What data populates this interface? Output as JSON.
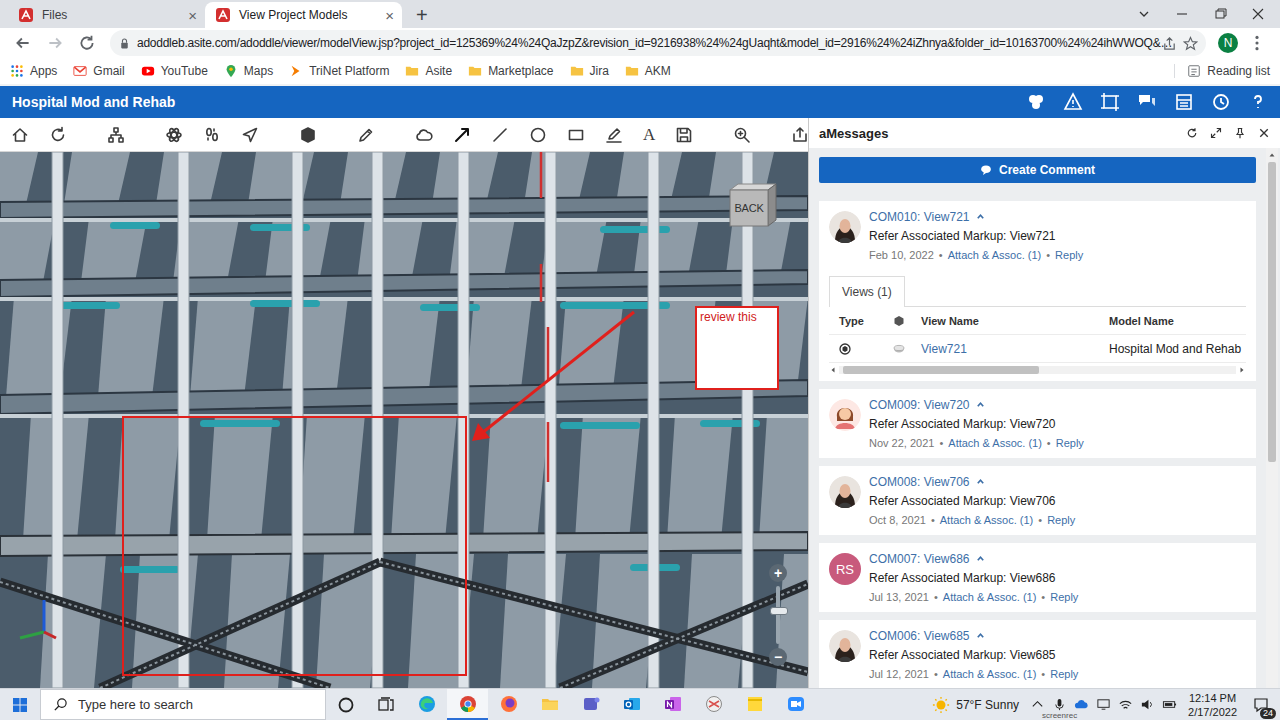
{
  "browser": {
    "tabs": [
      {
        "label": "Files",
        "selected": false,
        "close": "×"
      },
      {
        "label": "View Project Models",
        "selected": true,
        "close": "×"
      }
    ],
    "new_tab": "+",
    "url": "adoddleb.asite.com/adoddle/viewer/modelView.jsp?project_id=125369%24%24QaJzpZ&revision_id=9216938%24%24gUaqht&model_id=2916%24%24iZhnya&folder_id=10163700%24%24ihWWOQ&…",
    "profile": "N",
    "bookmarks": [
      {
        "label": "Apps",
        "kind": "apps"
      },
      {
        "label": "Gmail",
        "kind": "gmail"
      },
      {
        "label": "YouTube",
        "kind": "youtube"
      },
      {
        "label": "Maps",
        "kind": "maps"
      },
      {
        "label": "TriNet Platform",
        "kind": "trinet"
      },
      {
        "label": "Asite",
        "kind": "folder"
      },
      {
        "label": "Marketplace",
        "kind": "folder"
      },
      {
        "label": "Jira",
        "kind": "folder"
      },
      {
        "label": "AKM",
        "kind": "folder"
      }
    ],
    "reading_list": "Reading list"
  },
  "app": {
    "title": "Hospital Mod and Rehab",
    "text_tool": "A"
  },
  "viewer": {
    "view_cube": "BACK",
    "annotation": "review this",
    "zoom": {
      "in": "+",
      "out": "−",
      "level": 0.6
    }
  },
  "messages": {
    "title": "aMessages",
    "create": "Create Comment",
    "separator": "•",
    "comments": [
      {
        "id": "COM010: View721",
        "text": "Refer Associated Markup: View721",
        "date": "Feb 10, 2022",
        "attach": "Attach & Assoc. (1)",
        "reply": "Reply",
        "expanded": true,
        "avatar": {
          "kind": "photo"
        },
        "views": {
          "tab": "Views (1)",
          "columns": [
            "Type",
            "View Name",
            "Model Name"
          ],
          "rows": [
            {
              "view": "View721",
              "model": "Hospital Mod and Rehab"
            }
          ]
        }
      },
      {
        "id": "COM009: View720",
        "text": "Refer Associated Markup: View720",
        "date": "Nov 22, 2021",
        "attach": "Attach & Assoc. (1)",
        "reply": "Reply",
        "expanded": false,
        "avatar": {
          "kind": "cartoon"
        }
      },
      {
        "id": "COM008: View706",
        "text": "Refer Associated Markup: View706",
        "date": "Oct 8, 2021",
        "attach": "Attach & Assoc. (1)",
        "reply": "Reply",
        "expanded": false,
        "avatar": {
          "kind": "photo"
        }
      },
      {
        "id": "COM007: View686",
        "text": "Refer Associated Markup: View686",
        "date": "Jul 13, 2021",
        "attach": "Attach & Assoc. (1)",
        "reply": "Reply",
        "expanded": false,
        "avatar": {
          "kind": "initials",
          "initials": "RS",
          "color": "#c85a7c"
        }
      },
      {
        "id": "COM006: View685",
        "text": "Refer Associated Markup: View685",
        "date": "Jul 12, 2021",
        "attach": "Attach & Assoc. (1)",
        "reply": "Reply",
        "expanded": false,
        "avatar": {
          "kind": "photo"
        }
      }
    ]
  },
  "taskbar": {
    "search": "Type here to search",
    "apps": [
      {
        "kind": "edge",
        "active": false
      },
      {
        "kind": "chrome",
        "active": true
      },
      {
        "kind": "firefox",
        "active": false
      },
      {
        "kind": "explorer",
        "active": false
      },
      {
        "kind": "teams",
        "active": false
      },
      {
        "kind": "outlook",
        "active": false
      },
      {
        "kind": "onenote",
        "active": false
      },
      {
        "kind": "snip",
        "active": false
      },
      {
        "kind": "sticky",
        "active": false
      },
      {
        "kind": "zoom",
        "active": false
      }
    ],
    "weather": "57°F Sunny",
    "time": "12:14 PM",
    "date": "2/17/2022",
    "notifications": "24",
    "watermark": "screenrec"
  }
}
